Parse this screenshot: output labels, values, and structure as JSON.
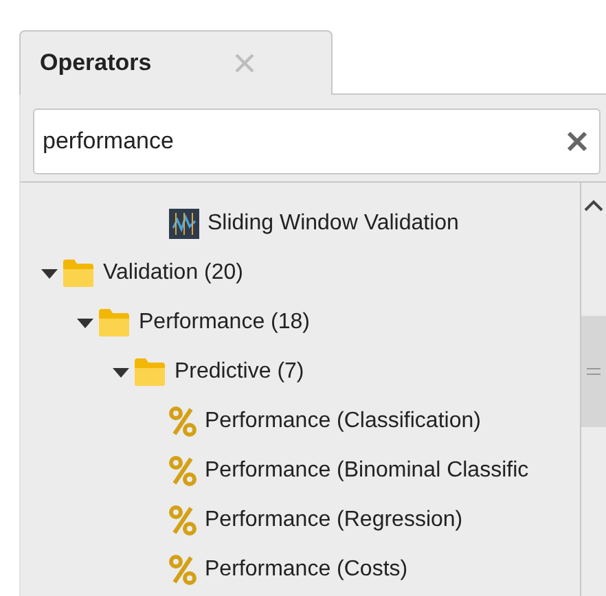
{
  "tab": {
    "label": "Operators",
    "selected": true
  },
  "search": {
    "value": "performance"
  },
  "tree": [
    {
      "children": [
        {
          "children": [
            {
              "children": [
                {
                  "kind": "validator",
                  "label": "Sliding Window Validation"
                }
              ]
            }
          ]
        }
      ]
    },
    {
      "kind": "folder",
      "label": "Validation (20)",
      "expanded": true,
      "children": [
        {
          "kind": "folder",
          "label": "Performance (18)",
          "expanded": true,
          "children": [
            {
              "kind": "folder",
              "label": "Predictive (7)",
              "expanded": true,
              "children": [
                {
                  "kind": "metric",
                  "label": "Performance (Classification)"
                },
                {
                  "kind": "metric",
                  "label": "Performance (Binominal Classific"
                },
                {
                  "kind": "metric",
                  "label": "Performance (Regression)"
                },
                {
                  "kind": "metric",
                  "label": "Performance (Costs)"
                }
              ]
            }
          ]
        }
      ]
    }
  ]
}
